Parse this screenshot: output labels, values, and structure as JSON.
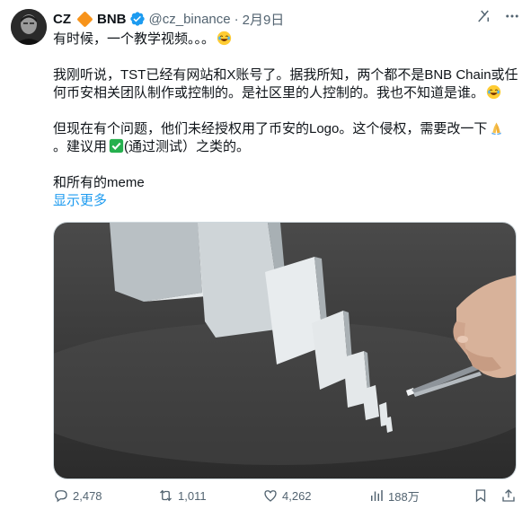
{
  "author": {
    "name": "CZ",
    "badge_text": "BNB",
    "handle": "@cz_binance",
    "separator": "·",
    "date": "2月9日"
  },
  "body": {
    "p1": "有时候，一个教学视频。。。",
    "p2_line1": "我刚听说，TST已经有网站和X账号了。据我所知，两个都不是BNB Chain或任",
    "p2_line2": "何币安相关团队制作或控制的。是社区里的人控制的。我也不知道是谁。",
    "p3_line1": "但现在有个问题，他们未经授权用了币安的Logo。这个侵权，需要改一下",
    "p3_line2_a": "。建议用",
    "p3_line2_b": "(通过测试）之类的。",
    "p4": "和所有的meme",
    "show_more": "显示更多"
  },
  "metrics": {
    "replies": "2,478",
    "retweets": "1,011",
    "likes": "4,262",
    "views": "188万"
  },
  "icons": {
    "top": [
      "grok-icon",
      "more-icon"
    ],
    "actions": [
      "reply-icon",
      "retweet-icon",
      "like-icon",
      "views-icon",
      "bookmark-icon",
      "share-icon"
    ]
  },
  "colors": {
    "accent": "#1d9bf0",
    "muted": "#536471",
    "verified": "#1d9bf0",
    "bnb_diamond": "#f7931a",
    "check_emoji": "#25b04e"
  }
}
